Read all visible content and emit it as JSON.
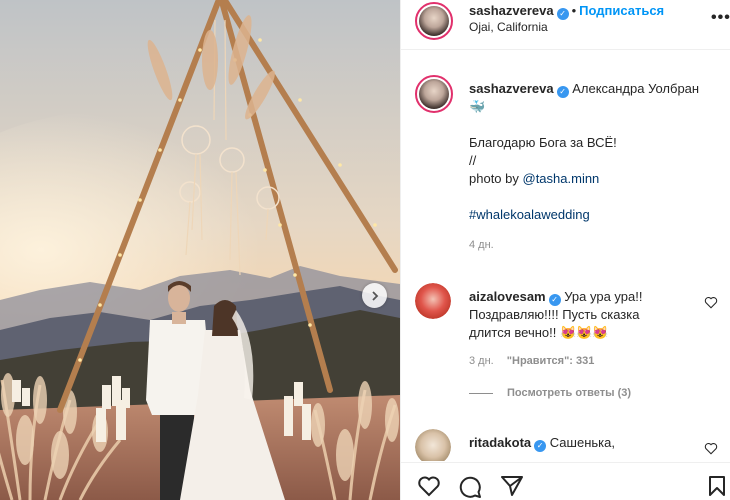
{
  "post_author": {
    "username": "sashazvereva",
    "verified_icon": "verified-badge-icon",
    "separator": "•",
    "follow_label": "Подписаться",
    "location": "Ojai, California"
  },
  "caption": {
    "username": "sashazvereva",
    "name_text": "Александра Уолбран",
    "emoji": "🐳",
    "line1": "Благодарю Бога за ВСЁ!",
    "line2": "//",
    "photo_prefix": "photo by ",
    "photo_link": "@tasha.minn",
    "hashtag": "#whalekoalawedding",
    "age": "4 дн."
  },
  "comments": [
    {
      "username": "aizalovesam",
      "text_line1": "Ура ура ура!!",
      "text_line2": "Поздравляю!!!! Пусть сказка",
      "text_line3": "длится вечно!! 😻😻😻",
      "age": "3 дн.",
      "likes": "\"Нравится\": 331",
      "replies": "Посмотреть ответы (3)"
    },
    {
      "username": "ritadakota",
      "text_line1": "Сашенька,"
    }
  ],
  "colors": {
    "accent": "#0095f6",
    "verified": "#3897f0",
    "ring": "#e1306c"
  }
}
